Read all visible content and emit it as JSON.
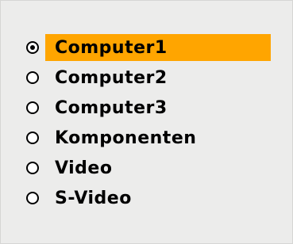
{
  "source_selector": {
    "selected_index": 0,
    "highlight_color": "#ffa500",
    "options": [
      {
        "label": "Computer1",
        "selected": true
      },
      {
        "label": "Computer2",
        "selected": false
      },
      {
        "label": "Computer3",
        "selected": false
      },
      {
        "label": "Komponenten",
        "selected": false
      },
      {
        "label": "Video",
        "selected": false
      },
      {
        "label": "S-Video",
        "selected": false
      }
    ]
  }
}
